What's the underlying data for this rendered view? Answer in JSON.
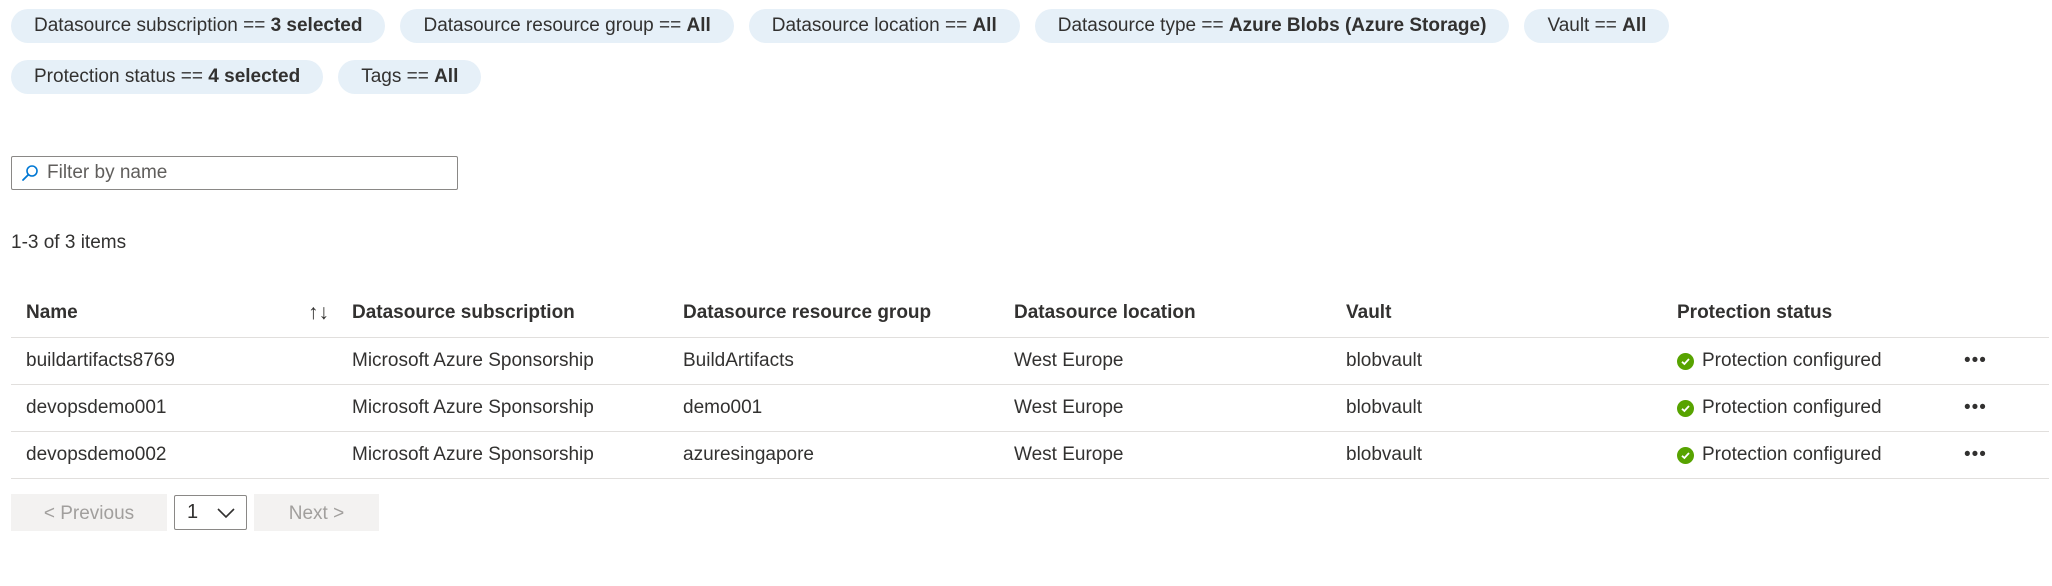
{
  "filters": [
    [
      {
        "label": "Datasource subscription ==",
        "value": "3 selected"
      },
      {
        "label": "Datasource resource group ==",
        "value": "All"
      },
      {
        "label": "Datasource location ==",
        "value": "All"
      },
      {
        "label": "Datasource type ==",
        "value": "Azure Blobs (Azure Storage)"
      },
      {
        "label": "Vault ==",
        "value": "All"
      }
    ],
    [
      {
        "label": "Protection status ==",
        "value": "4 selected"
      },
      {
        "label": "Tags ==",
        "value": "All"
      }
    ]
  ],
  "search": {
    "placeholder": "Filter by name",
    "value": ""
  },
  "item_count": "1-3 of 3 items",
  "table": {
    "columns": [
      "Name",
      "Datasource subscription",
      "Datasource resource group",
      "Datasource location",
      "Vault",
      "Protection status"
    ],
    "rows": [
      {
        "name": "buildartifacts8769",
        "subscription": "Microsoft Azure Sponsorship",
        "resource_group": "BuildArtifacts",
        "location": "West Europe",
        "vault": "blobvault",
        "status": "Protection configured"
      },
      {
        "name": "devopsdemo001",
        "subscription": "Microsoft Azure Sponsorship",
        "resource_group": "demo001",
        "location": "West Europe",
        "vault": "blobvault",
        "status": "Protection configured"
      },
      {
        "name": "devopsdemo002",
        "subscription": "Microsoft Azure Sponsorship",
        "resource_group": "azuresingapore",
        "location": "West Europe",
        "vault": "blobvault",
        "status": "Protection configured"
      }
    ]
  },
  "pager": {
    "previous": "< Previous",
    "page": "1",
    "next": "Next >"
  },
  "colors": {
    "pill_bg": "#e6f0f8",
    "status_ok": "#57a300",
    "disabled_text": "#a19f9d"
  },
  "icons": {
    "search": "search-icon",
    "sort": "sort-icon",
    "status": "checkmark-circle-icon",
    "more": "more-icon",
    "dropdown": "chevron-down-icon"
  }
}
